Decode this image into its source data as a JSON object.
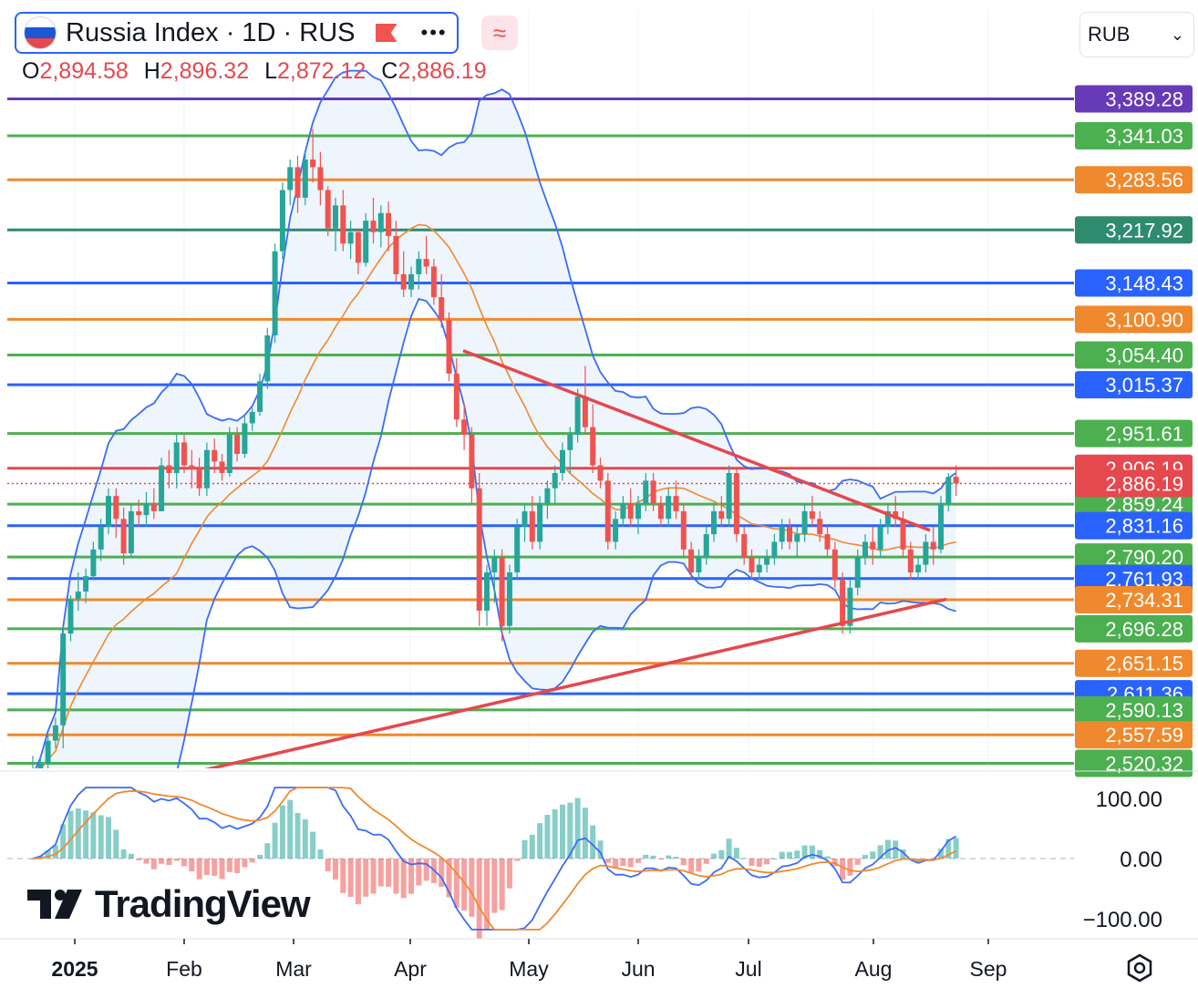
{
  "header": {
    "symbol_title": "Russia Index · 1D · RUS",
    "more_icon": "more-dots-icon",
    "indicator_icon": "approx-wave-icon",
    "ohlc": {
      "open_label": "O",
      "open": "2,894.58",
      "high_label": "H",
      "high": "2,896.32",
      "low_label": "L",
      "low": "2,872.12",
      "close_label": "C",
      "close": "2,886.19"
    },
    "currency": "RUB"
  },
  "watermark": "TradingView",
  "colors": {
    "up": "#26a69a",
    "down": "#ef5350",
    "bollinger": "#3b6cf6",
    "ma": "#f0892d",
    "trendline": "#e5484d",
    "band_fill": "#eaf2fb"
  },
  "chart_data": [
    {
      "type": "candlestick",
      "title": "Russia Index · 1D · RUS",
      "x_ticks": [
        "2025",
        "Feb",
        "Mar",
        "Apr",
        "May",
        "Jun",
        "Jul",
        "Aug",
        "Sep"
      ],
      "ylim": [
        2505,
        3430
      ],
      "last_close": 2886.19,
      "candles": [
        [
          2500,
          2530,
          2480,
          2505
        ],
        [
          2505,
          2530,
          2500,
          2520
        ],
        [
          2520,
          2560,
          2510,
          2550
        ],
        [
          2550,
          2580,
          2540,
          2570
        ],
        [
          2570,
          2700,
          2540,
          2690
        ],
        [
          2690,
          2740,
          2680,
          2735
        ],
        [
          2735,
          2770,
          2720,
          2745
        ],
        [
          2745,
          2775,
          2730,
          2765
        ],
        [
          2765,
          2810,
          2760,
          2800
        ],
        [
          2800,
          2840,
          2785,
          2830
        ],
        [
          2830,
          2880,
          2820,
          2870
        ],
        [
          2870,
          2880,
          2815,
          2840
        ],
        [
          2840,
          2855,
          2780,
          2795
        ],
        [
          2795,
          2860,
          2790,
          2850
        ],
        [
          2850,
          2865,
          2830,
          2845
        ],
        [
          2845,
          2875,
          2830,
          2860
        ],
        [
          2860,
          2880,
          2840,
          2850
        ],
        [
          2850,
          2920,
          2850,
          2910
        ],
        [
          2910,
          2930,
          2880,
          2900
        ],
        [
          2900,
          2950,
          2880,
          2940
        ],
        [
          2940,
          2950,
          2900,
          2910
        ],
        [
          2910,
          2930,
          2880,
          2905
        ],
        [
          2905,
          2920,
          2870,
          2880
        ],
        [
          2880,
          2940,
          2870,
          2930
        ],
        [
          2930,
          2945,
          2900,
          2915
        ],
        [
          2915,
          2925,
          2890,
          2900
        ],
        [
          2900,
          2960,
          2895,
          2950
        ],
        [
          2950,
          2960,
          2915,
          2925
        ],
        [
          2925,
          2975,
          2920,
          2965
        ],
        [
          2965,
          2985,
          2955,
          2980
        ],
        [
          2980,
          3030,
          2975,
          3020
        ],
        [
          3020,
          3090,
          3010,
          3080
        ],
        [
          3080,
          3200,
          3070,
          3190
        ],
        [
          3190,
          3280,
          3180,
          3270
        ],
        [
          3270,
          3310,
          3250,
          3300
        ],
        [
          3300,
          3315,
          3240,
          3260
        ],
        [
          3260,
          3320,
          3250,
          3310
        ],
        [
          3310,
          3350,
          3280,
          3300
        ],
        [
          3300,
          3320,
          3250,
          3270
        ],
        [
          3270,
          3275,
          3210,
          3220
        ],
        [
          3220,
          3260,
          3190,
          3250
        ],
        [
          3250,
          3270,
          3190,
          3200
        ],
        [
          3200,
          3230,
          3180,
          3215
        ],
        [
          3215,
          3220,
          3160,
          3175
        ],
        [
          3175,
          3240,
          3170,
          3230
        ],
        [
          3230,
          3260,
          3200,
          3215
        ],
        [
          3215,
          3250,
          3195,
          3240
        ],
        [
          3240,
          3255,
          3190,
          3210
        ],
        [
          3210,
          3230,
          3150,
          3160
        ],
        [
          3160,
          3190,
          3130,
          3140
        ],
        [
          3140,
          3170,
          3130,
          3160
        ],
        [
          3160,
          3190,
          3140,
          3180
        ],
        [
          3180,
          3210,
          3160,
          3170
        ],
        [
          3170,
          3180,
          3120,
          3130
        ],
        [
          3130,
          3160,
          3090,
          3100
        ],
        [
          3100,
          3110,
          3020,
          3030
        ],
        [
          3030,
          3050,
          2960,
          2970
        ],
        [
          2970,
          2990,
          2930,
          2950
        ],
        [
          2950,
          2960,
          2860,
          2880
        ],
        [
          2880,
          2900,
          2700,
          2720
        ],
        [
          2720,
          2780,
          2700,
          2770
        ],
        [
          2770,
          2800,
          2730,
          2790
        ],
        [
          2790,
          2800,
          2680,
          2700
        ],
        [
          2700,
          2780,
          2690,
          2770
        ],
        [
          2770,
          2840,
          2760,
          2830
        ],
        [
          2830,
          2860,
          2810,
          2850
        ],
        [
          2850,
          2870,
          2800,
          2810
        ],
        [
          2810,
          2870,
          2800,
          2860
        ],
        [
          2860,
          2890,
          2840,
          2880
        ],
        [
          2880,
          2910,
          2860,
          2900
        ],
        [
          2900,
          2940,
          2890,
          2930
        ],
        [
          2930,
          2960,
          2900,
          2950
        ],
        [
          2950,
          3010,
          2940,
          3000
        ],
        [
          3000,
          3040,
          2950,
          2960
        ],
        [
          2960,
          2990,
          2900,
          2910
        ],
        [
          2910,
          2920,
          2880,
          2890
        ],
        [
          2890,
          2900,
          2800,
          2810
        ],
        [
          2810,
          2850,
          2800,
          2840
        ],
        [
          2840,
          2870,
          2830,
          2860
        ],
        [
          2860,
          2880,
          2830,
          2840
        ],
        [
          2840,
          2870,
          2820,
          2860
        ],
        [
          2860,
          2900,
          2850,
          2890
        ],
        [
          2890,
          2900,
          2850,
          2860
        ],
        [
          2860,
          2870,
          2830,
          2840
        ],
        [
          2840,
          2880,
          2830,
          2870
        ],
        [
          2870,
          2890,
          2840,
          2850
        ],
        [
          2850,
          2860,
          2790,
          2800
        ],
        [
          2800,
          2810,
          2760,
          2770
        ],
        [
          2770,
          2800,
          2760,
          2790
        ],
        [
          2790,
          2830,
          2780,
          2820
        ],
        [
          2820,
          2860,
          2810,
          2850
        ],
        [
          2850,
          2870,
          2830,
          2840
        ],
        [
          2840,
          2910,
          2830,
          2900
        ],
        [
          2900,
          2905,
          2810,
          2820
        ],
        [
          2820,
          2830,
          2780,
          2790
        ],
        [
          2790,
          2800,
          2760,
          2770
        ],
        [
          2770,
          2790,
          2760,
          2780
        ],
        [
          2780,
          2800,
          2770,
          2790
        ],
        [
          2790,
          2820,
          2780,
          2810
        ],
        [
          2810,
          2840,
          2800,
          2830
        ],
        [
          2830,
          2840,
          2800,
          2810
        ],
        [
          2810,
          2830,
          2790,
          2820
        ],
        [
          2820,
          2860,
          2810,
          2850
        ],
        [
          2850,
          2870,
          2830,
          2840
        ],
        [
          2840,
          2850,
          2810,
          2820
        ],
        [
          2820,
          2830,
          2790,
          2800
        ],
        [
          2800,
          2810,
          2750,
          2760
        ],
        [
          2760,
          2770,
          2690,
          2700
        ],
        [
          2700,
          2760,
          2690,
          2750
        ],
        [
          2750,
          2800,
          2740,
          2790
        ],
        [
          2790,
          2820,
          2780,
          2810
        ],
        [
          2810,
          2830,
          2780,
          2800
        ],
        [
          2800,
          2840,
          2790,
          2830
        ],
        [
          2830,
          2860,
          2820,
          2850
        ],
        [
          2850,
          2870,
          2830,
          2840
        ],
        [
          2840,
          2850,
          2790,
          2800
        ],
        [
          2800,
          2810,
          2760,
          2770
        ],
        [
          2770,
          2790,
          2760,
          2780
        ],
        [
          2780,
          2820,
          2770,
          2810
        ],
        [
          2810,
          2830,
          2780,
          2800
        ],
        [
          2800,
          2870,
          2795,
          2860
        ],
        [
          2860,
          2900,
          2850,
          2895
        ],
        [
          2895,
          2910,
          2870,
          2886.19
        ]
      ],
      "hlines": [
        {
          "price": 3389.28,
          "label": "3,389.28",
          "color": "#673ab7"
        },
        {
          "price": 3341.03,
          "label": "3,341.03",
          "color": "#4caf50"
        },
        {
          "price": 3283.56,
          "label": "3,283.56",
          "color": "#f0892d"
        },
        {
          "price": 3217.92,
          "label": "3,217.92",
          "color": "#2e8b6e"
        },
        {
          "price": 3148.43,
          "label": "3,148.43",
          "color": "#2962ff"
        },
        {
          "price": 3100.9,
          "label": "3,100.90",
          "color": "#f0892d"
        },
        {
          "price": 3054.4,
          "label": "3,054.40",
          "color": "#4caf50"
        },
        {
          "price": 3015.37,
          "label": "3,015.37",
          "color": "#2962ff"
        },
        {
          "price": 2951.61,
          "label": "2,951.61",
          "color": "#4caf50"
        },
        {
          "price": 2906.19,
          "label": "2,906.19",
          "color": "#e5484d"
        },
        {
          "price": 2859.24,
          "label": "2,859.24",
          "color": "#4caf50"
        },
        {
          "price": 2831.16,
          "label": "2,831.16",
          "color": "#2962ff"
        },
        {
          "price": 2790.2,
          "label": "2,790.20",
          "color": "#4caf50"
        },
        {
          "price": 2761.93,
          "label": "2,761.93",
          "color": "#2962ff"
        },
        {
          "price": 2734.31,
          "label": "2,734.31",
          "color": "#f0892d"
        },
        {
          "price": 2696.28,
          "label": "2,696.28",
          "color": "#4caf50"
        },
        {
          "price": 2651.15,
          "label": "2,651.15",
          "color": "#f0892d"
        },
        {
          "price": 2611.36,
          "label": "2,611.36",
          "color": "#2962ff"
        },
        {
          "price": 2590.13,
          "label": "2,590.13",
          "color": "#4caf50"
        },
        {
          "price": 2557.59,
          "label": "2,557.59",
          "color": "#f0892d"
        },
        {
          "price": 2520.32,
          "label": "2,520.32",
          "color": "#4caf50"
        }
      ],
      "current_price_label": "2,886.19",
      "current_price_color": "#e5484d",
      "trendlines": [
        {
          "from": [
            "Apr 15",
            3060
          ],
          "to": [
            "Aug 12",
            2825
          ]
        },
        {
          "from": [
            "Jan 16",
            2505
          ],
          "to": [
            "Aug 12",
            2735
          ]
        }
      ]
    },
    {
      "type": "oscillator",
      "y_ticks": [
        100.0,
        0.0,
        -100.0
      ],
      "y_tick_labels": [
        "100.00",
        "0.00",
        "−100.00"
      ],
      "ylim": [
        -120,
        120
      ],
      "series": [
        {
          "role": "signal-fast",
          "color": "#3b6cf6"
        },
        {
          "role": "signal-slow",
          "color": "#f0892d"
        }
      ]
    }
  ]
}
